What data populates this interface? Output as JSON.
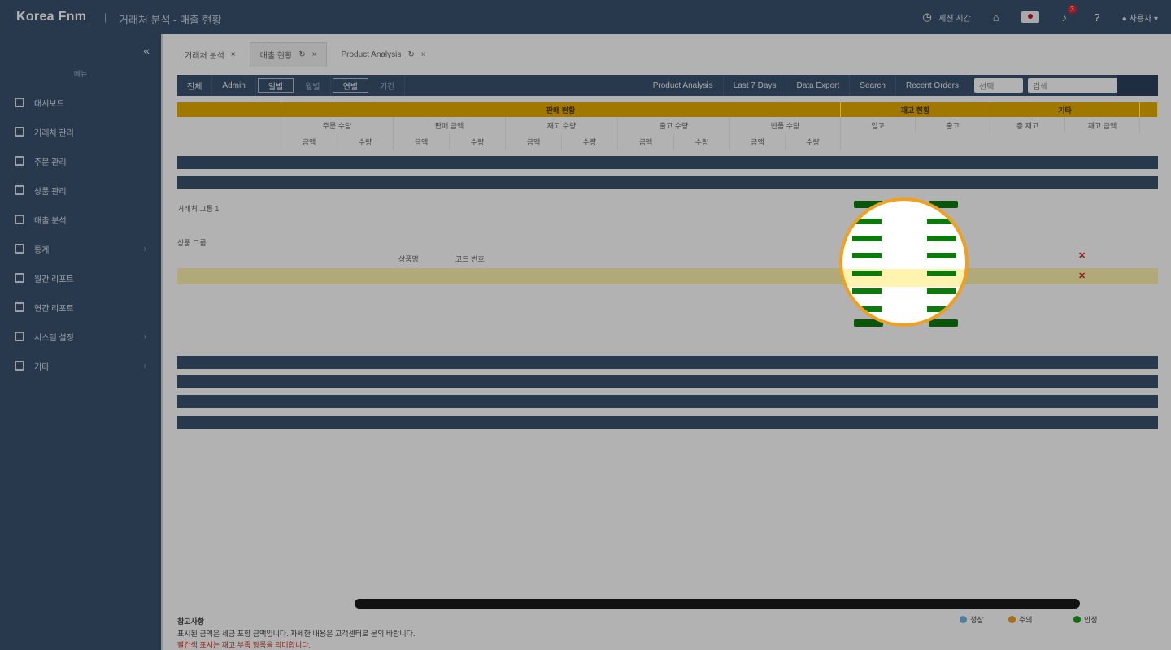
{
  "header": {
    "brand": "Korea Fnm",
    "subtitle": "거래처 분석 - 매출 현황",
    "session": "세션 시간",
    "notify_count": "3",
    "user": "사용자"
  },
  "sidebar": {
    "section_label": "메뉴",
    "items": [
      {
        "label": "대시보드"
      },
      {
        "label": "거래처 관리"
      },
      {
        "label": "주문 관리"
      },
      {
        "label": "상품 관리"
      },
      {
        "label": "매출 분석"
      },
      {
        "label": "통계"
      },
      {
        "label": "월간 리포트"
      },
      {
        "label": "연간 리포트"
      },
      {
        "label": "시스템 설정"
      },
      {
        "label": "기타"
      }
    ]
  },
  "tabs": [
    {
      "label": "거래처 분석"
    },
    {
      "label": "매출 현황"
    },
    {
      "label": "Product Analysis"
    }
  ],
  "toolbar": {
    "items": [
      "전체",
      "Admin",
      "일별",
      "월별",
      "연별",
      "기간"
    ],
    "right_items": [
      "Product Analysis",
      "Last 7 Days",
      "Data Export",
      "Search",
      "Recent Orders"
    ],
    "select_placeholder": "선택",
    "search_placeholder": "검색"
  },
  "table_header": {
    "bands": [
      "",
      "판매 현황",
      "재고 현황",
      "기타"
    ],
    "columns": [
      "주문 수량",
      "판매 금액",
      "재고 수량",
      "출고 수량",
      "반품 수량",
      "입고",
      "출고",
      "총 재고",
      "재고 금액"
    ],
    "subcolumns": [
      "금액",
      "수량",
      "금액",
      "수량",
      "금액",
      "수량",
      "금액",
      "수량",
      "금액",
      "수량"
    ]
  },
  "rows": {
    "group1": "거래처 그룹 1",
    "group2": "상품 그룹",
    "item_label": "상품명",
    "item_code": "코드 번호"
  },
  "scroll": {
    "horizontal_fraction": 0.72
  },
  "footer": {
    "note_title": "참고사항",
    "note_line1": "표시된 금액은 세금 포함 금액입니다. 자세한 내용은 고객센터로 문의 바랍니다.",
    "note_line2": "빨간색 표시는 재고 부족 항목을 의미합니다."
  },
  "legend": [
    {
      "label": "정상",
      "color": "#6fb3e0"
    },
    {
      "label": "주의",
      "color": "#f0a020"
    },
    {
      "label": "안정",
      "color": "#1e9a1e"
    }
  ],
  "colors": {
    "navy": "#3b526f",
    "band": "#e6ac00",
    "pill": "#0d7a0d",
    "highlight": "#fff3b0",
    "magnifier_ring": "#f0a020"
  }
}
